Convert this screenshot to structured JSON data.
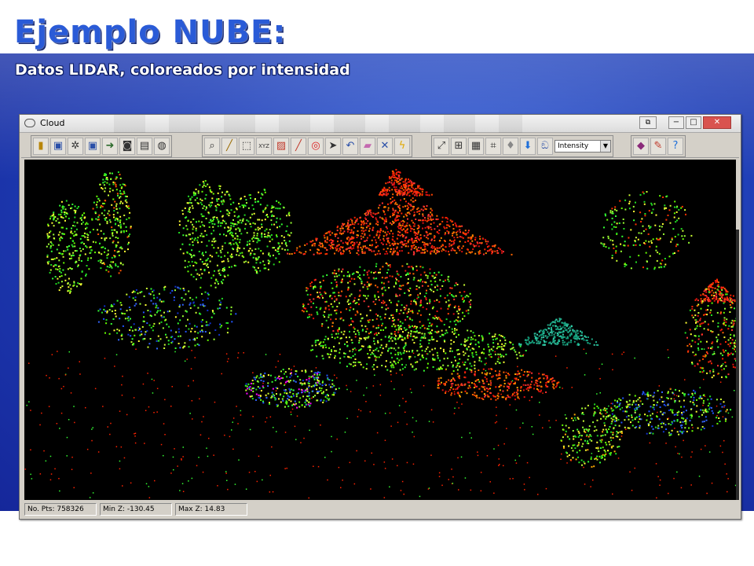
{
  "slide": {
    "title": "Ejemplo NUBE:",
    "subtitle": "Datos LIDAR, coloreados por intensidad"
  },
  "window": {
    "title": "Cloud",
    "buttons": {
      "restore": "⧉",
      "minimize": "−",
      "maximize": "□",
      "close": "✕"
    }
  },
  "toolbar": {
    "group1_icons": [
      "open-icon",
      "save-icon",
      "settings-icon",
      "save-as-icon",
      "export-icon",
      "camera-icon",
      "print-icon",
      "globe-icon"
    ],
    "group2_icons": [
      "zoom-icon",
      "measure-icon",
      "select-icon",
      "xyz-icon",
      "hatch-icon",
      "slope-icon",
      "target-icon",
      "pointer-icon",
      "undo-icon",
      "erase-icon",
      "close-x-icon",
      "lightning-icon"
    ],
    "group3_icons": [
      "fit-icon",
      "grid-view-icon",
      "panel-icon",
      "mesh-icon",
      "bulb-icon",
      "down-arrow-icon",
      "animal-icon"
    ],
    "color_mode": "Intensity",
    "group4_icons": [
      "book-icon",
      "edit-book-icon",
      "help-icon"
    ]
  },
  "status": {
    "points": "No. Pts: 758326",
    "min_z": "Min Z: -130.45",
    "max_z": "Max Z: 14.83"
  }
}
